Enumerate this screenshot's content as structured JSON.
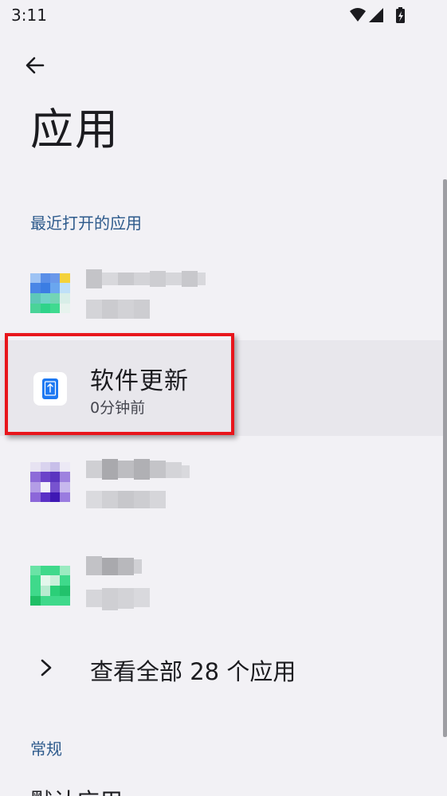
{
  "status_bar": {
    "time": "3:11",
    "icons": [
      "wifi-icon",
      "cell-signal-icon",
      "battery-charging-icon"
    ]
  },
  "header": {
    "back_icon": "arrow-left-icon",
    "title": "应用"
  },
  "recent_section": {
    "title": "最近打开的应用",
    "apps": [
      {
        "name": "",
        "subtitle": "",
        "icon": "pixelated-app-icon",
        "blurred": true
      },
      {
        "name": "软件更新",
        "subtitle": "0分钟前",
        "icon": "software-update-icon",
        "blurred": false,
        "selected": true
      },
      {
        "name": "",
        "subtitle": "",
        "icon": "pixelated-app-icon",
        "blurred": true
      },
      {
        "name": "",
        "subtitle": "",
        "icon": "pixelated-app-icon",
        "blurred": true
      }
    ],
    "see_all_label": "查看全部 28 个应用"
  },
  "general_section": {
    "title": "常规",
    "first_item": "默认应用"
  },
  "colors": {
    "background": "#f2f1f5",
    "section_header": "#2d5a8c",
    "selected_row": "#e8e7ec",
    "highlight_border": "#e8161c"
  }
}
